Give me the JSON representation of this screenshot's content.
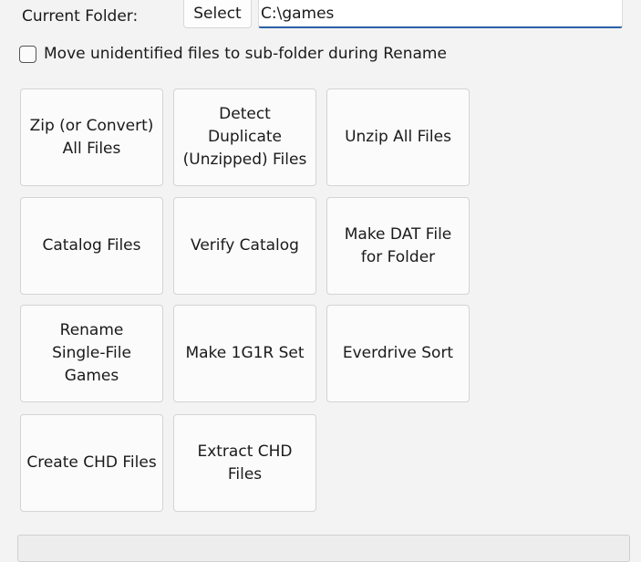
{
  "folder": {
    "label": "Current Folder:",
    "select_label": "Select",
    "path_value": "C:\\games"
  },
  "options": {
    "move_unidentified_label": "Move unidentified files to sub-folder during Rename",
    "move_unidentified_checked": false
  },
  "actions": {
    "zip": "Zip (or Convert)\nAll Files",
    "detect_duplicate": "Detect Duplicate\n(Unzipped) Files",
    "unzip": "Unzip All Files",
    "catalog": "Catalog Files",
    "verify_catalog": "Verify Catalog",
    "make_dat": "Make DAT File\nfor Folder",
    "rename_single": "Rename\nSingle-File\nGames",
    "make_1g1r": "Make 1G1R Set",
    "everdrive_sort": "Everdrive Sort",
    "create_chd": "Create CHD Files",
    "extract_chd": "Extract CHD Files"
  }
}
